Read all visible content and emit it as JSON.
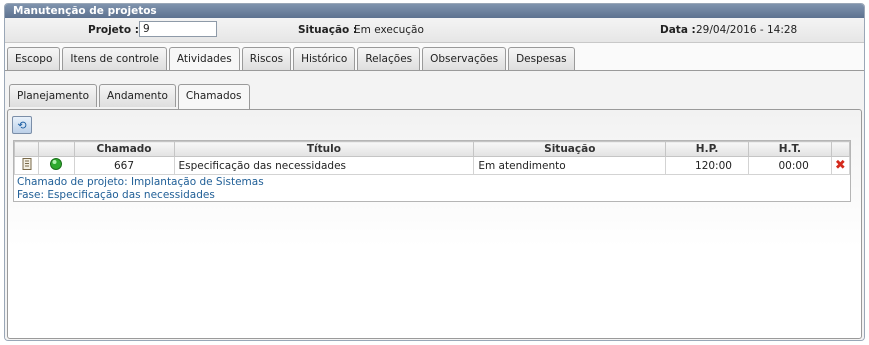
{
  "window_title": "Manutenção de projetos",
  "info": {
    "projeto_label": "Projeto :",
    "projeto_value": "9",
    "situacao_label": "Situação :",
    "situacao_value": "Em execução",
    "data_label": "Data :",
    "data_value": "29/04/2016 - 14:28"
  },
  "tabs": [
    "Escopo",
    "Itens de controle",
    "Atividades",
    "Riscos",
    "Histórico",
    "Relações",
    "Observações",
    "Despesas"
  ],
  "active_tab": "Atividades",
  "subtabs": [
    "Planejamento",
    "Andamento",
    "Chamados"
  ],
  "active_subtab": "Chamados",
  "table": {
    "headers": [
      "",
      "",
      "Chamado",
      "Título",
      "Situação",
      "H.P.",
      "H.T.",
      ""
    ],
    "rows": [
      {
        "icon1": "document-icon",
        "icon2": "green-status-icon",
        "chamado": "667",
        "titulo": "Especificação das necessidades",
        "situacao": "Em atendimento",
        "hp": "120:00",
        "ht": "00:00",
        "action": "delete-icon"
      }
    ],
    "detail_line1": "Chamado de projeto: Implantação de Sistemas",
    "detail_line2": "Fase: Especificação das necessidades"
  },
  "colors": {
    "titlebar": "#6b7f9c",
    "detail_text": "#1f5e96",
    "status_green": "#2eaa2e",
    "delete_red": "#d42a1c"
  }
}
